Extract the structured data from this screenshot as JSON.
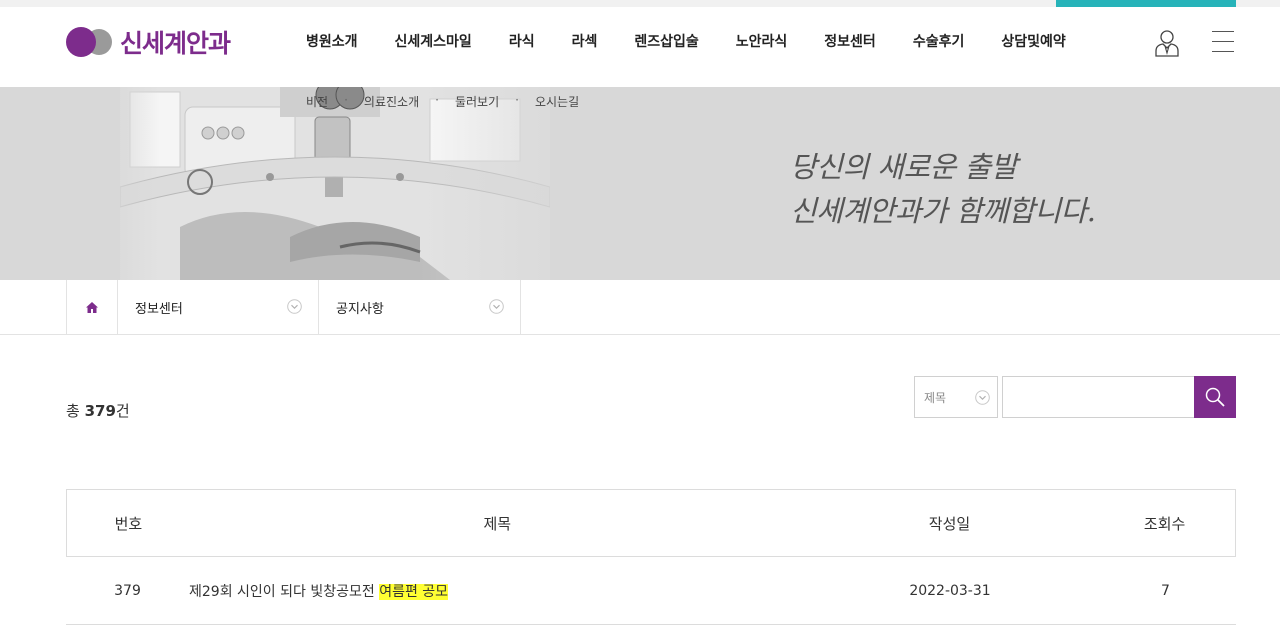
{
  "header": {
    "logo_text": "신세계안과",
    "brand_color": "#7d2c8c",
    "accent_color": "#27b3b9",
    "menu": [
      "병원소개",
      "신세계스마일",
      "라식",
      "라섹",
      "렌즈삽입술",
      "노안라식",
      "정보센터",
      "수술후기",
      "상담및예약"
    ],
    "user_icon": "user-icon",
    "menu_icon": "hamburger-icon"
  },
  "submenu": [
    "비전",
    "의료진소개",
    "둘러보기",
    "오시는길"
  ],
  "hero": {
    "slogan_line1": "당신의 새로운 출발",
    "slogan_line2": "신세계안과가 함께합니다."
  },
  "location": {
    "home_icon": "home-icon",
    "level1": "정보센터",
    "level2": "공지사항"
  },
  "board": {
    "total_prefix": "총 ",
    "total_count": "379",
    "total_suffix": "건",
    "search_field": "제목",
    "search_value": "",
    "search_icon": "search-icon",
    "columns": [
      "번호",
      "제목",
      "작성일",
      "조회수"
    ],
    "rows": [
      {
        "num": "379",
        "title_plain": "제29회 시인이 되다 빛창공모전 ",
        "title_highlight": "여름편 공모",
        "date": "2022-03-31",
        "views": "7"
      }
    ]
  }
}
